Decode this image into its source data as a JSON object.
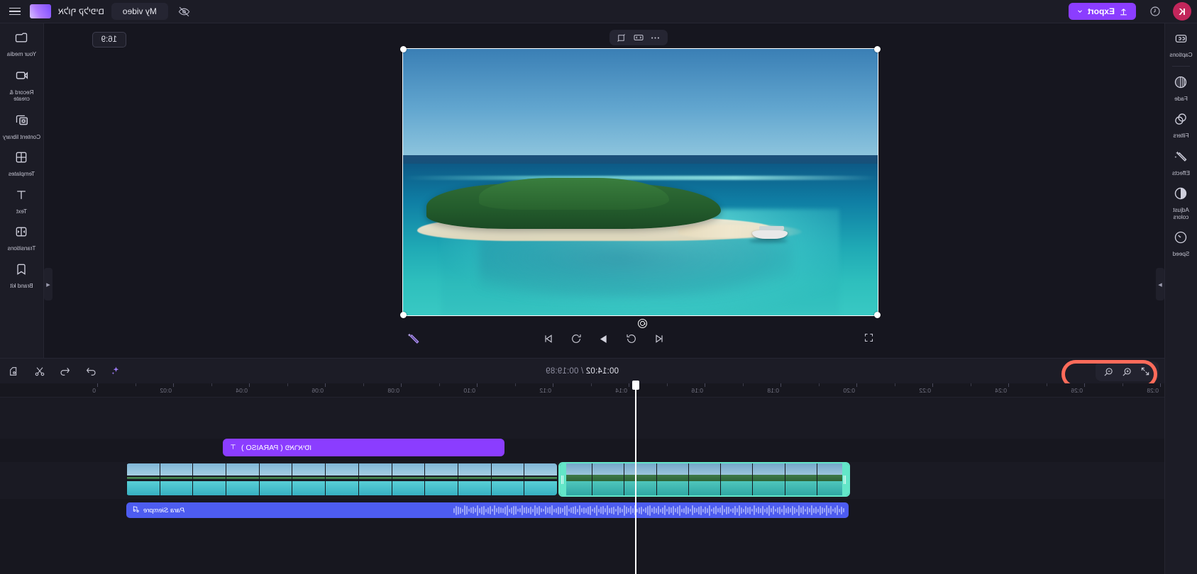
{
  "app": {
    "logo_letter": "K",
    "export_label": "Export",
    "project_name": "My video",
    "account_name": "אלוף קליפים"
  },
  "topbar": {
    "clock_icon": "history-icon",
    "upload_icon": "upload-icon",
    "chevron_icon": "chevron-down-icon",
    "eye_off_icon": "eye-off-icon",
    "menu_icon": "hamburger-menu-icon"
  },
  "left_rail": {
    "items": [
      {
        "label": "Captions",
        "icon": "captions-icon"
      },
      {
        "label": "Fade",
        "icon": "fade-icon"
      },
      {
        "label": "Filters",
        "icon": "filters-icon"
      },
      {
        "label": "Effects",
        "icon": "effects-wand-icon"
      },
      {
        "label": "Adjust colors",
        "icon": "adjust-colors-icon"
      },
      {
        "label": "Speed",
        "icon": "speed-gauge-icon"
      }
    ]
  },
  "right_rail": {
    "items": [
      {
        "label": "Your media",
        "icon": "folder-icon"
      },
      {
        "label": "Record & create",
        "icon": "record-create-icon"
      },
      {
        "label": "Content library",
        "icon": "content-library-icon"
      },
      {
        "label": "Templates",
        "icon": "templates-grid-icon"
      },
      {
        "label": "Text",
        "icon": "text-t-icon"
      },
      {
        "label": "Transitions",
        "icon": "transitions-icon"
      },
      {
        "label": "Brand kit",
        "icon": "brand-kit-icon"
      }
    ]
  },
  "canvas": {
    "ratio_badge": "16:9",
    "float_tools": [
      {
        "name": "more-options-icon",
        "glyph": "•••"
      },
      {
        "name": "crop-fit-icon",
        "glyph": ""
      },
      {
        "name": "rotate-flip-icon",
        "glyph": ""
      }
    ],
    "selection_handles": 4,
    "rotate_handle": "rotate-handle-icon"
  },
  "playback": {
    "fullscreen_icon": "fullscreen-icon",
    "skip_start_icon": "skip-to-start-icon",
    "rewind_icon": "rewind-5s-icon",
    "play_icon": "play-icon",
    "forward_icon": "forward-5s-icon",
    "skip_end_icon": "skip-to-end-icon",
    "ai_icon": "ai-magic-wand-icon"
  },
  "timeline": {
    "zoom_controls": [
      {
        "name": "fit-to-screen-icon",
        "label": "Fit"
      },
      {
        "name": "zoom-in-icon",
        "label": "Zoom in"
      },
      {
        "name": "zoom-out-icon",
        "label": "Zoom out"
      }
    ],
    "highlight_color": "#ff6b5a",
    "current_time": "00:14:02",
    "separator": " / ",
    "total_time": "00:19:89",
    "tools": [
      {
        "name": "duplicate-icon"
      },
      {
        "name": "split-scissors-icon"
      },
      {
        "name": "undo-icon"
      },
      {
        "name": "redo-icon"
      },
      {
        "name": "ai-sparkle-icon"
      }
    ],
    "ruler_ticks": [
      "0",
      "0:02",
      "0:04",
      "0:06",
      "0:08",
      "0:10",
      "0:12",
      "0:14",
      "0:16",
      "0:18",
      "0:20",
      "0:22",
      "0:24",
      "0:26",
      "0:28"
    ],
    "text_clip": {
      "label": "פאראיסו ( PARAISO )",
      "icon": "text-t-icon",
      "color": "#8b3dff"
    },
    "video_clips": [
      {
        "name": "clip-selected",
        "selected": true,
        "accent": "#63e6c8"
      },
      {
        "name": "clip-second",
        "selected": false,
        "accent": "#9fd8ef"
      }
    ],
    "audio_clip": {
      "label": "Para Siempre",
      "icon": "music-note-icon",
      "color": "#4d5cf0"
    }
  }
}
